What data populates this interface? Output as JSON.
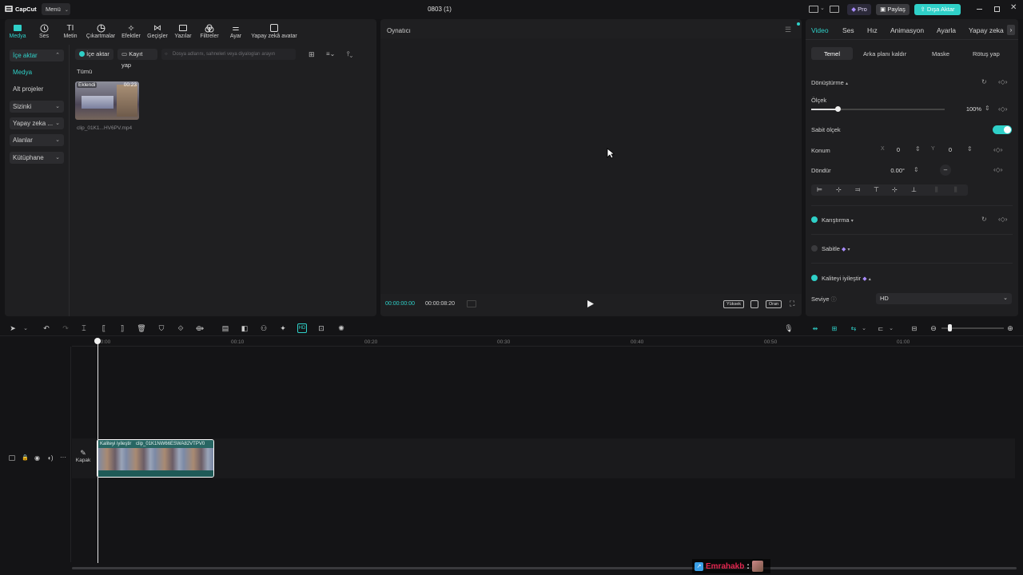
{
  "app": {
    "logo": "CapCut",
    "menu_label": "Menü",
    "project_title": "0803 (1)",
    "pro_label": "Pro",
    "share_label": "Paylaş",
    "export_label": "Dışa Aktar",
    "accent": "#2fd0c8"
  },
  "media_tabs": [
    {
      "label": "Medya",
      "icon": "media-icon"
    },
    {
      "label": "Ses",
      "icon": "audio-icon"
    },
    {
      "label": "Metin",
      "icon": "text-icon"
    },
    {
      "label": "Çıkartmalar",
      "icon": "stickers-icon"
    },
    {
      "label": "Efektler",
      "icon": "effects-icon"
    },
    {
      "label": "Geçişler",
      "icon": "transitions-icon"
    },
    {
      "label": "Yazılar",
      "icon": "captions-icon"
    },
    {
      "label": "Filtreler",
      "icon": "filters-icon"
    },
    {
      "label": "Ayar",
      "icon": "adjust-icon"
    },
    {
      "label": "Yapay zekâ avatar",
      "icon": "ai-avatar-icon"
    }
  ],
  "sidebar": {
    "items": [
      {
        "label": "İçe aktar"
      },
      {
        "label": "Medya"
      },
      {
        "label": "Alt projeler"
      },
      {
        "label": "Sizinki"
      },
      {
        "label": "Yapay zeka ..."
      },
      {
        "label": "Alanlar"
      },
      {
        "label": "Kütüphane"
      }
    ]
  },
  "media": {
    "import_label": "İçe aktar",
    "record_label": "Kayıt yap",
    "search_placeholder": "Dosya adlarını, sahneleri veya diyalogları arayın",
    "filter_all": "Tümü",
    "clip_badge": "Eklendi",
    "clip_duration": "00:23",
    "clip_name": "clip_01K1...HV6PV.mp4"
  },
  "player": {
    "title": "Oynatıcı",
    "current_time": "00:00:00:00",
    "total_time": "00:00:08:20",
    "quality_label": "Yüksek",
    "ratio_label": "Oran"
  },
  "inspector": {
    "tabs": [
      "Video",
      "Ses",
      "Hız",
      "Animasyon",
      "Ayarla",
      "Yapay zeka"
    ],
    "subtabs": [
      "Temel",
      "Arka planı kaldır",
      "Maske",
      "Rötuş yap"
    ],
    "transform_label": "Dönüştürme",
    "scale_label": "Ölçek",
    "scale_value": "100%",
    "scale_fraction": 0.2,
    "uniform_scale_label": "Sabit ölçek",
    "position_label": "Konum",
    "pos_x_label": "X",
    "pos_x_value": "0",
    "pos_y_label": "Y",
    "pos_y_value": "0",
    "rotate_label": "Döndür",
    "rotate_value": "0.00°",
    "blend_label": "Karıştırma",
    "stabilize_label": "Sabitle",
    "enhance_label": "Kaliteyi iyileştir",
    "level_label": "Seviye",
    "level_value": "HD"
  },
  "timeline": {
    "ticks": [
      "00:00",
      "00:10",
      "00:20",
      "00:30",
      "00:40",
      "00:50",
      "01:00"
    ],
    "clip_label_tag": "Kaliteyi iyileştir",
    "clip_label_name": "clip_01K1NW66ESWA82VTPV0",
    "cover_label": "Kapak"
  },
  "watermark": {
    "name": "Emrahakb",
    "sep": ":"
  }
}
